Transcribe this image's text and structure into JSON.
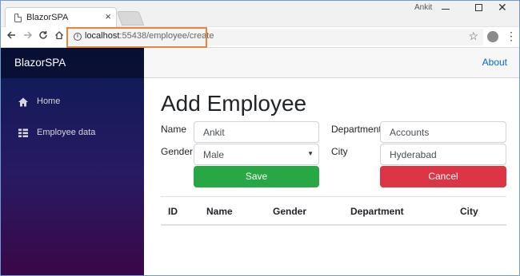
{
  "browser": {
    "tab_title": "BlazorSPA",
    "tab_close": "×",
    "profile_name": "Ankit",
    "url_host": "localhost",
    "url_path": ":55438/employee/create",
    "controls": {
      "close": "✕"
    }
  },
  "sidebar": {
    "brand": "BlazorSPA",
    "items": [
      {
        "label": "Home",
        "icon": "home-icon"
      },
      {
        "label": "Employee data",
        "icon": "list-icon"
      }
    ]
  },
  "topbar": {
    "about": "About"
  },
  "form": {
    "title": "Add Employee",
    "name_label": "Name",
    "name_value": "Ankit",
    "gender_label": "Gender",
    "gender_value": "Male",
    "department_label": "Department",
    "department_value": "Accounts",
    "city_label": "City",
    "city_value": "Hyderabad",
    "save_label": "Save",
    "cancel_label": "Cancel"
  },
  "table": {
    "headers": [
      "ID",
      "Name",
      "Gender",
      "Department",
      "City"
    ],
    "rows": []
  },
  "colors": {
    "save": "#28a745",
    "cancel": "#dc3545",
    "link": "#0366d6",
    "address_highlight": "#e8853a"
  }
}
